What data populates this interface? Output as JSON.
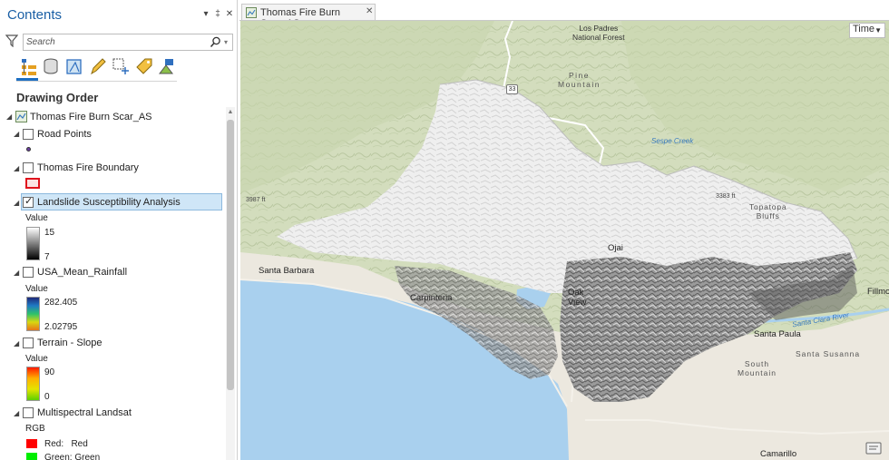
{
  "contents": {
    "title": "Contents",
    "controls": {
      "menu": "▾",
      "pin": "‡",
      "close": "✕"
    },
    "search": {
      "placeholder": "Search",
      "value": ""
    },
    "icons": [
      "filter-icon",
      "list-by-drawing-order-icon",
      "list-by-source-icon",
      "list-by-selection-icon",
      "list-by-editing-icon",
      "list-by-snapping-icon",
      "list-by-labeling-icon",
      "list-by-perspective-imagery-icon"
    ],
    "section_title": "Drawing Order",
    "map_node": {
      "label": "Thomas Fire Burn Scar_AS"
    },
    "layers": [
      {
        "label": "Road Points",
        "checked": false
      },
      {
        "label": "Thomas Fire Boundary",
        "checked": false
      },
      {
        "label": "Landslide Susceptibility Analysis",
        "checked": true,
        "legend_title": "Value",
        "high": "15",
        "low": "7"
      },
      {
        "label": "USA_Mean_Rainfall",
        "checked": false,
        "legend_title": "Value",
        "high": "282.405",
        "low": "2.02795"
      },
      {
        "label": "Terrain - Slope",
        "checked": false,
        "legend_title": "Value",
        "high": "90",
        "low": "0"
      },
      {
        "label": "Multispectral Landsat",
        "checked": false,
        "legend_title": "RGB",
        "bands": [
          {
            "label": "Red:   Red",
            "color": "#ff0000"
          },
          {
            "label": "Green: Green",
            "color": "#00ee00"
          }
        ]
      }
    ]
  },
  "map_view": {
    "tab_label": "Thomas Fire Burn Scar_AS",
    "time_button": "Time",
    "labels": {
      "los_padres": "Los Padres\nNational Forest",
      "pine_mountain": "Pine\nMountain",
      "route_33": "33",
      "sespe_creek": "Sespe Creek",
      "elev_3987": "3987 ft",
      "elev_3383": "3383 ft",
      "topatopa": "Topatopa\nBluffs",
      "santa_barbara": "Santa Barbara",
      "ojai": "Ojai",
      "carpinteria": "Carpinteria",
      "oak_view": "Oak\nView",
      "fillmore": "Fillmo",
      "santa_clara_river": "Santa Clara River",
      "santa_paula": "Santa Paula",
      "south_mountain": "South\nMountain",
      "santa_susanna": "Santa Susanna",
      "camarillo": "Camarillo"
    }
  },
  "colors": {
    "accent": "#1e6fc2",
    "selection": "#cfe6f7",
    "water": "#a9d0ee",
    "terrain": "#d6e0c2",
    "burn_light": "#f4f4f4"
  }
}
